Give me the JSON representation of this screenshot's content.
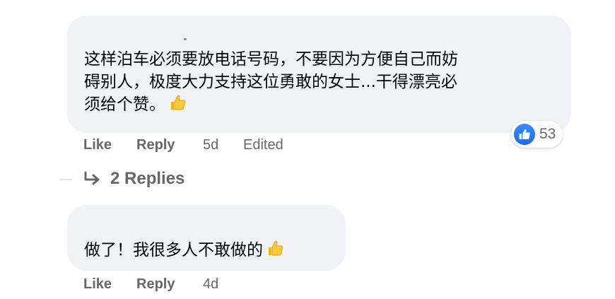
{
  "comments": [
    {
      "text_line1": "这样泊车必须要放电话号码，不要因为方便自己而妨",
      "text_line2": "碍别人，极度大力支持这位勇敢的女士...干得漂亮必",
      "text_line3": "须给个赞。",
      "emoji": "thumbs-up-emoji",
      "actions": {
        "like": "Like",
        "reply": "Reply",
        "time": "5d",
        "edited": "Edited"
      },
      "reactions": {
        "icon": "like-reaction-icon",
        "count": "53"
      }
    },
    {
      "text": "做了！我很多人不敢做的",
      "emoji": "thumbs-up-emoji",
      "actions": {
        "like": "Like",
        "reply": "Reply",
        "time": "4d"
      }
    }
  ],
  "replies_toggle": {
    "label": "2 Replies"
  },
  "colors": {
    "bubble": "#f0f2f5",
    "text": "#050505",
    "meta": "#65676b",
    "like_blue": "#1877f2"
  }
}
